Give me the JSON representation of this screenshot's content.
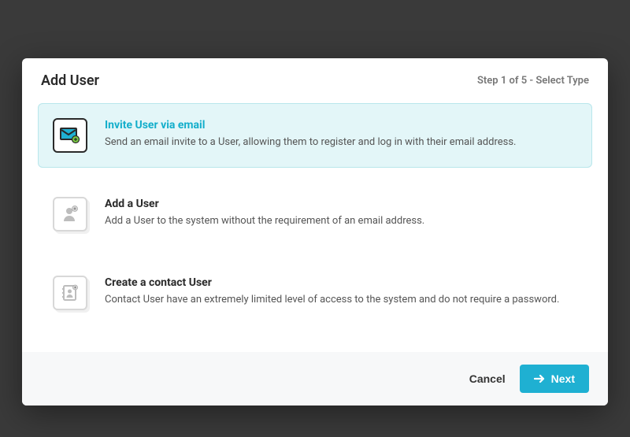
{
  "modal": {
    "title": "Add User",
    "step_indicator": "Step 1 of 5 - Select Type",
    "options": [
      {
        "title": "Invite User via email",
        "description": "Send an email invite to a User, allowing them to register and log in with their email address.",
        "selected": true,
        "icon": "envelope-invite-icon"
      },
      {
        "title": "Add a User",
        "description": "Add a User to the system without the requirement of an email address.",
        "selected": false,
        "icon": "user-add-icon"
      },
      {
        "title": "Create a contact User",
        "description": "Contact User have an extremely limited level of access to the system and do not require a password.",
        "selected": false,
        "icon": "address-book-icon"
      }
    ],
    "footer": {
      "cancel_label": "Cancel",
      "next_label": "Next"
    }
  },
  "colors": {
    "accent": "#1fb0d2",
    "selected_bg": "#e3f6f8",
    "text_primary": "#2a2a2a",
    "text_secondary": "#555"
  }
}
